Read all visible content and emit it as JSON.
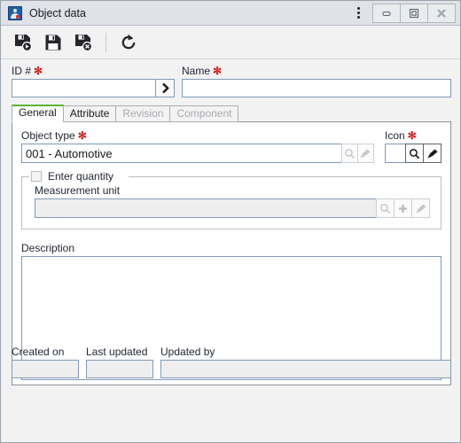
{
  "window": {
    "title": "Object data",
    "app_icon": "object-data-icon",
    "menu_icon": "kebab-menu-icon",
    "controls": [
      {
        "name": "minimize-button",
        "icon": "minimize-icon"
      },
      {
        "name": "maximize-button",
        "icon": "maximize-icon"
      },
      {
        "name": "close-button",
        "icon": "close-icon"
      }
    ]
  },
  "toolbar": {
    "buttons": [
      {
        "name": "save-and-new-button",
        "icon": "save-new-icon",
        "label": "Save and new"
      },
      {
        "name": "save-button",
        "icon": "save-icon",
        "label": "Save"
      },
      {
        "name": "save-and-close-button",
        "icon": "save-close-icon",
        "label": "Save and close"
      },
      {
        "name": "refresh-button",
        "icon": "refresh-icon",
        "label": "Refresh"
      }
    ]
  },
  "form": {
    "id": {
      "label": "ID #",
      "required_marker": "✻",
      "value": "",
      "placeholder": "",
      "browse_icon": "chevron-right-icon"
    },
    "name": {
      "label": "Name",
      "required_marker": "✻",
      "value": "",
      "placeholder": ""
    }
  },
  "tabs": [
    {
      "label": "General",
      "state": "active"
    },
    {
      "label": "Attribute",
      "state": "enabled"
    },
    {
      "label": "Revision",
      "state": "disabled"
    },
    {
      "label": "Component",
      "state": "disabled"
    }
  ],
  "general": {
    "object_type": {
      "label": "Object type",
      "required_marker": "✻",
      "value": "001 - Automotive",
      "search_icon": "magnifier-icon",
      "clear_icon": "brush-icon"
    },
    "icon_field": {
      "label": "Icon",
      "required_marker": "✻",
      "value": "",
      "search_icon": "magnifier-icon",
      "clear_icon": "brush-icon"
    },
    "enter_quantity": {
      "label": "Enter quantity",
      "checked": false
    },
    "measurement_unit": {
      "label": "Measurement unit",
      "value": "",
      "placeholder": "",
      "search_icon": "magnifier-icon",
      "add_icon": "plus-icon",
      "clear_icon": "brush-icon"
    },
    "description": {
      "label": "Description",
      "value": "",
      "placeholder": ""
    }
  },
  "footer": {
    "created_on": {
      "label": "Created on",
      "value": ""
    },
    "last_updated": {
      "label": "Last updated",
      "value": ""
    },
    "updated_by": {
      "label": "Updated by",
      "value": ""
    }
  },
  "colors": {
    "titlebar": "#dfe2e7",
    "window_bg": "#f2f2f2",
    "field_border": "#7f9ab8",
    "active_tab_accent": "#5fb336",
    "required_marker": "#d21f1f",
    "app_icon_blue": "#1f5fa9"
  }
}
